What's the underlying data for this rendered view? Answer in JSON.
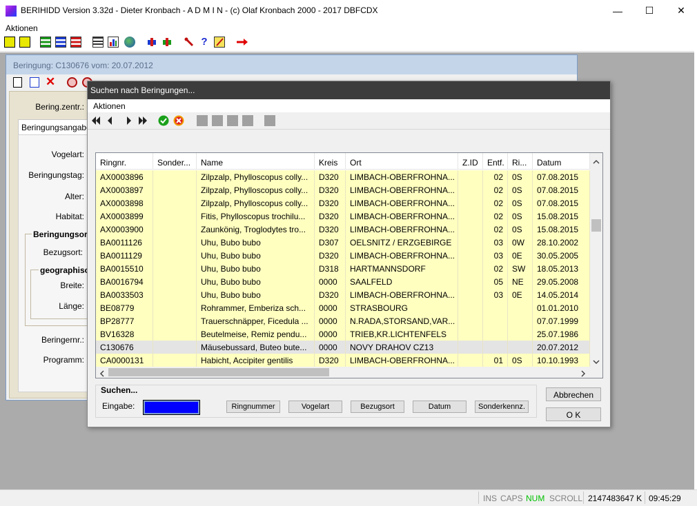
{
  "window": {
    "title": "BERIHIDD Version 3.32d - Dieter Kronbach - A D M I N - (c) Olaf Kronbach 2000 - 2017  DBFCDX",
    "minimize": "—",
    "maximize": "☐",
    "close": "✕"
  },
  "menu": {
    "aktionen": "Aktionen"
  },
  "child": {
    "title": "Beringung: C130676   vom: 20.07.2012",
    "ring_center_label": "Bering.zentr.:",
    "tab_label": "Beringungsangaben",
    "vogelart_label": "Vogelart:",
    "beringungstag_label": "Beringungstag:",
    "alter_label": "Alter:",
    "habitat_label": "Habitat:",
    "beringungsort_group": "Beringungsort...",
    "bezugsort_label": "Bezugsort:",
    "geo_group": "geographische",
    "breite_label": "Breite:",
    "laenge_label": "Länge:",
    "beringernr_label": "Beringernr.:",
    "programm_label": "Programm:"
  },
  "dialog": {
    "title": "Suchen nach Beringungen...",
    "menu_aktionen": "Aktionen",
    "columns": [
      "Ringnr.",
      "Sonder...",
      "Name",
      "Kreis",
      "Ort",
      "Z.ID",
      "Entf.",
      "Ri...",
      "Datum"
    ],
    "rows": [
      {
        "ringnr": "AX0003896",
        "sonder": "",
        "name": "Zilpzalp, Phylloscopus colly...",
        "kreis": "D320",
        "ort": "LIMBACH-OBERFROHNA...",
        "zid": "",
        "entf": "02",
        "ri": "0S",
        "datum": "07.08.2015"
      },
      {
        "ringnr": "AX0003897",
        "sonder": "",
        "name": "Zilpzalp, Phylloscopus colly...",
        "kreis": "D320",
        "ort": "LIMBACH-OBERFROHNA...",
        "zid": "",
        "entf": "02",
        "ri": "0S",
        "datum": "07.08.2015"
      },
      {
        "ringnr": "AX0003898",
        "sonder": "",
        "name": "Zilpzalp, Phylloscopus colly...",
        "kreis": "D320",
        "ort": "LIMBACH-OBERFROHNA...",
        "zid": "",
        "entf": "02",
        "ri": "0S",
        "datum": "07.08.2015"
      },
      {
        "ringnr": "AX0003899",
        "sonder": "",
        "name": "Fitis, Phylloscopus trochilu...",
        "kreis": "D320",
        "ort": "LIMBACH-OBERFROHNA...",
        "zid": "",
        "entf": "02",
        "ri": "0S",
        "datum": "15.08.2015"
      },
      {
        "ringnr": "AX0003900",
        "sonder": "",
        "name": "Zaunkönig, Troglodytes tro...",
        "kreis": "D320",
        "ort": "LIMBACH-OBERFROHNA...",
        "zid": "",
        "entf": "02",
        "ri": "0S",
        "datum": "15.08.2015"
      },
      {
        "ringnr": "BA0011126",
        "sonder": "",
        "name": "Uhu, Bubo bubo",
        "kreis": "D307",
        "ort": "OELSNITZ / ERZGEBIRGE",
        "zid": "",
        "entf": "03",
        "ri": "0W",
        "datum": "28.10.2002"
      },
      {
        "ringnr": "BA0011129",
        "sonder": "",
        "name": "Uhu, Bubo bubo",
        "kreis": "D320",
        "ort": "LIMBACH-OBERFROHNA...",
        "zid": "",
        "entf": "03",
        "ri": "0E",
        "datum": "30.05.2005"
      },
      {
        "ringnr": "BA0015510",
        "sonder": "",
        "name": "Uhu, Bubo bubo",
        "kreis": "D318",
        "ort": "HARTMANNSDORF",
        "zid": "",
        "entf": "02",
        "ri": "SW",
        "datum": "18.05.2013"
      },
      {
        "ringnr": "BA0016794",
        "sonder": "",
        "name": "Uhu, Bubo bubo",
        "kreis": "0000",
        "ort": "SAALFELD",
        "zid": "",
        "entf": "05",
        "ri": "NE",
        "datum": "29.05.2008"
      },
      {
        "ringnr": "BA0033503",
        "sonder": "",
        "name": "Uhu, Bubo bubo",
        "kreis": "D320",
        "ort": "LIMBACH-OBERFROHNA...",
        "zid": "",
        "entf": "03",
        "ri": "0E",
        "datum": "14.05.2014"
      },
      {
        "ringnr": "BE08779",
        "sonder": "",
        "name": "Rohrammer, Emberiza sch...",
        "kreis": "0000",
        "ort": "STRASBOURG",
        "zid": "",
        "entf": "",
        "ri": "",
        "datum": "01.01.2010"
      },
      {
        "ringnr": "BP28777",
        "sonder": "",
        "name": "Trauerschnäpper, Ficedula ...",
        "kreis": "0000",
        "ort": "N.RADA,STORSAND,VAR...",
        "zid": "",
        "entf": "",
        "ri": "",
        "datum": "07.07.1999"
      },
      {
        "ringnr": "BV16328",
        "sonder": "",
        "name": "Beutelmeise, Remiz pendu...",
        "kreis": "0000",
        "ort": "TRIEB,KR.LICHTENFELS",
        "zid": "",
        "entf": "",
        "ri": "",
        "datum": "25.07.1986"
      },
      {
        "ringnr": "C130676",
        "sonder": "",
        "name": "Mäusebussard, Buteo bute...",
        "kreis": "0000",
        "ort": "NOVY DRAHOV CZ13",
        "zid": "",
        "entf": "",
        "ri": "",
        "datum": "20.07.2012",
        "selected": true
      },
      {
        "ringnr": "CA0000131",
        "sonder": "",
        "name": "Habicht, Accipiter gentilis",
        "kreis": "D320",
        "ort": "LIMBACH-OBERFROHNA...",
        "zid": "",
        "entf": "01",
        "ri": "0S",
        "datum": "10.10.1993"
      }
    ],
    "search_group": "Suchen...",
    "eingabe_label": "Eingabe:",
    "eingabe_value": "",
    "btn_ringnummer": "Ringnummer",
    "btn_vogelart": "Vogelart",
    "btn_bezugsort": "Bezugsort",
    "btn_datum": "Datum",
    "btn_sonderkennz": "Sonderkennz.",
    "btn_abbrechen": "Abbrechen",
    "btn_ok": "O K"
  },
  "status": {
    "ins": "INS",
    "caps": "CAPS",
    "num": "NUM",
    "scroll": "SCROLL",
    "memory": "2147483647 K",
    "time": "09:45:29"
  },
  "colors": {
    "row_yellow": "#ffffc0",
    "row_selected": "#e4e4e4",
    "num_active": "#00c000",
    "input_blue": "#0000ff",
    "dialog_title": "#3c3c3c"
  }
}
